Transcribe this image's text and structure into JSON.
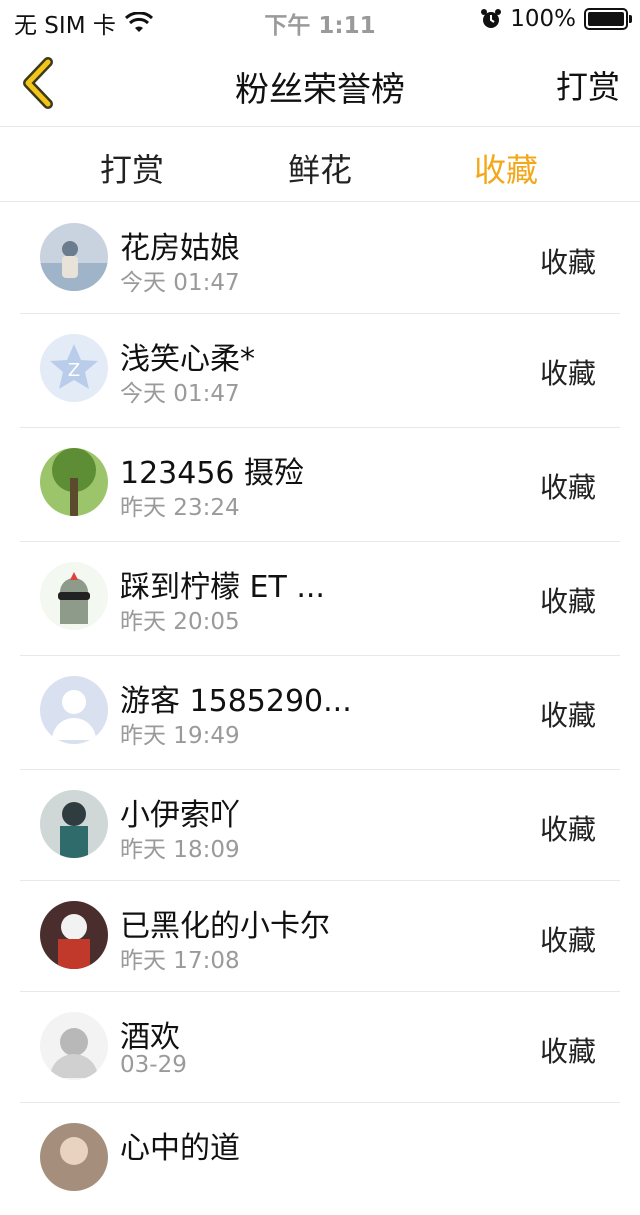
{
  "status_bar": {
    "carrier": "无 SIM 卡",
    "time": "下午 1:11",
    "battery": "100%"
  },
  "nav": {
    "title": "粉丝荣誉榜",
    "action": "打赏",
    "accent": "#f3a81b"
  },
  "tabs": [
    {
      "label": "打赏",
      "active": false
    },
    {
      "label": "鲜花",
      "active": false
    },
    {
      "label": "收藏",
      "active": true
    }
  ],
  "fans": [
    {
      "name": "花房姑娘",
      "time": "今天 01:47",
      "action": "收藏",
      "avatar": "photo-avatar"
    },
    {
      "name": "浅笑心柔*",
      "time": "今天 01:47",
      "action": "收藏",
      "avatar": "default-star-avatar"
    },
    {
      "name": "123456 摄殓",
      "time": "昨天 23:24",
      "action": "收藏",
      "avatar": "tree-avatar"
    },
    {
      "name": "踩到柠檬 ET ...",
      "time": "昨天 20:05",
      "action": "收藏",
      "avatar": "cartoon-avatar"
    },
    {
      "name": "游客 1585290...",
      "time": "昨天 19:49",
      "action": "收藏",
      "avatar": "default-person-avatar"
    },
    {
      "name": "小伊索吖",
      "time": "昨天 18:09",
      "action": "收藏",
      "avatar": "anime-avatar"
    },
    {
      "name": "已黑化的小卡尔",
      "time": "昨天 17:08",
      "action": "收藏",
      "avatar": "anime-avatar"
    },
    {
      "name": "酒欢",
      "time": "03-29",
      "action": "收藏",
      "avatar": "sketch-avatar"
    },
    {
      "name": "心中的道",
      "time": "",
      "action": "",
      "avatar": "photo-avatar"
    }
  ]
}
